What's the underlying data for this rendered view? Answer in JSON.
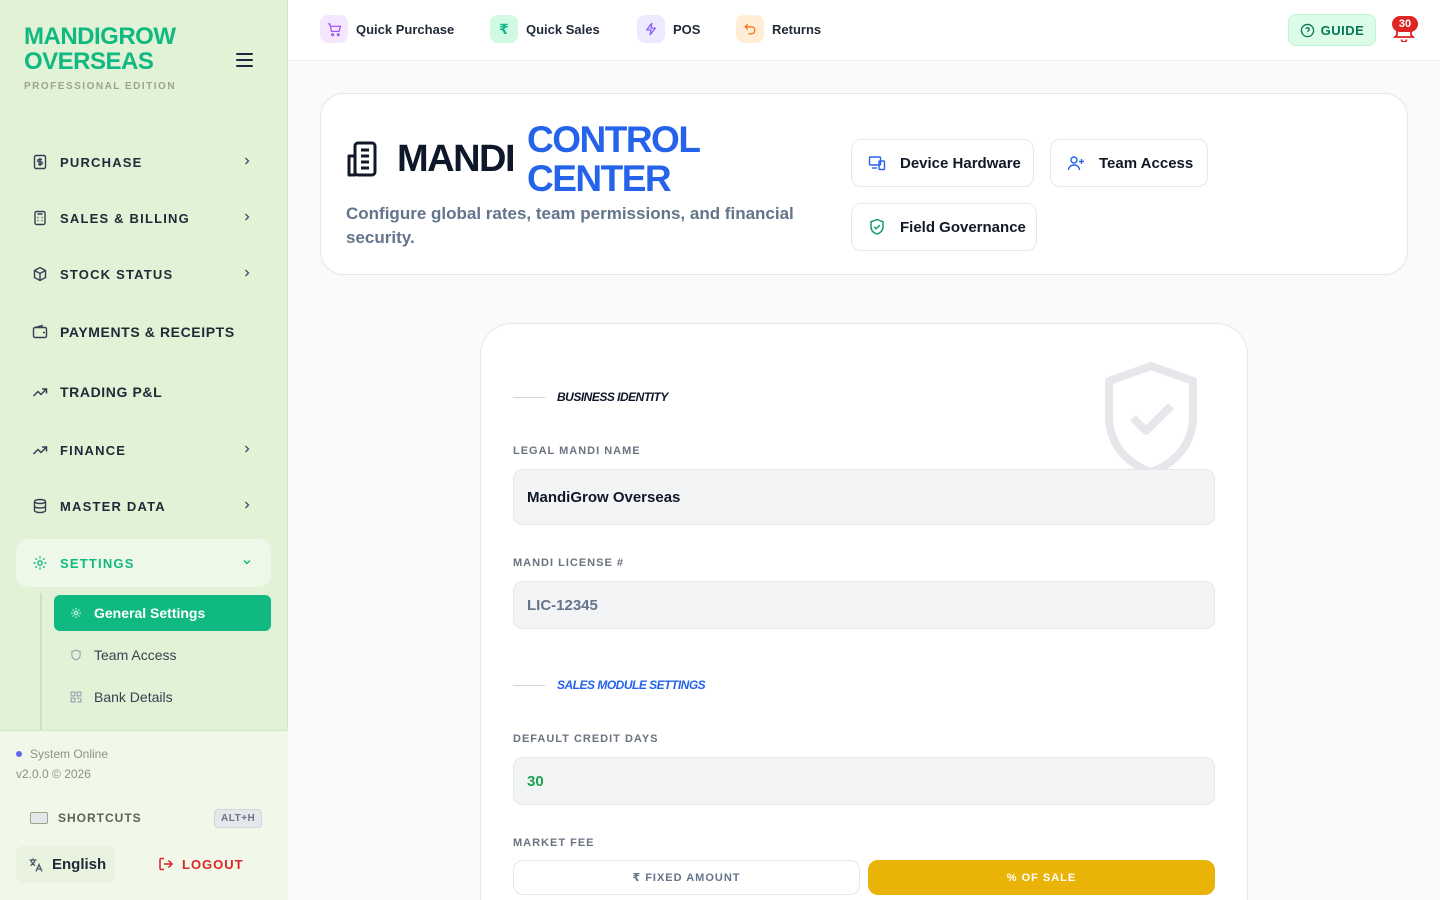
{
  "brand": {
    "line1": "MANDIGROW",
    "line2": "OVERSEAS",
    "edition": "PROFESSIONAL EDITION"
  },
  "sidebar": {
    "items": [
      {
        "label": "PURCHASE",
        "icon": "receipt-icon",
        "has_chevron": true
      },
      {
        "label": "SALES & BILLING",
        "icon": "calculator-icon",
        "has_chevron": true
      },
      {
        "label": "STOCK STATUS",
        "icon": "box-icon",
        "has_chevron": true
      },
      {
        "label": "PAYMENTS & RECEIPTS",
        "icon": "wallet-icon",
        "has_chevron": false
      },
      {
        "label": "TRADING P&L",
        "icon": "trending-up-icon",
        "has_chevron": false
      },
      {
        "label": "FINANCE",
        "icon": "trending-up-icon",
        "has_chevron": true
      },
      {
        "label": "MASTER DATA",
        "icon": "database-icon",
        "has_chevron": true
      },
      {
        "label": "SETTINGS",
        "icon": "gear-icon",
        "has_chevron": true,
        "expanded": true
      }
    ],
    "sub_items": [
      {
        "label": "General Settings",
        "icon": "gear-icon",
        "active": true
      },
      {
        "label": "Team Access",
        "icon": "shield-icon",
        "active": false
      },
      {
        "label": "Bank Details",
        "icon": "qr-icon",
        "active": false
      }
    ],
    "footer": {
      "status": "System Online",
      "version": "v2.0.0 © 2026",
      "shortcuts_label": "SHORTCUTS",
      "shortcuts_key": "ALT+H",
      "language": "English",
      "logout": "LOGOUT"
    }
  },
  "topbar": {
    "quick_actions": [
      {
        "label": "Quick Purchase",
        "icon": "cart-icon",
        "color": "#a855f7",
        "bg": "#f3e8ff"
      },
      {
        "label": "Quick Sales",
        "icon": "rupee-icon",
        "color": "#10b981",
        "bg": "#d1fae5"
      },
      {
        "label": "POS",
        "icon": "zap-icon",
        "color": "#8b5cf6",
        "bg": "#ede9fe"
      },
      {
        "label": "Returns",
        "icon": "undo-icon",
        "color": "#f97316",
        "bg": "#ffedd5"
      }
    ],
    "guide_label": "GUIDE",
    "notification_count": "30"
  },
  "header": {
    "title_part1": "MANDI",
    "title_part2_line1": "CONTROL",
    "title_part2_line2": "CENTER",
    "subtitle": "Configure global rates, team permissions, and financial security.",
    "buttons": [
      {
        "label": "Device Hardware",
        "icon": "devices-icon",
        "color": "#2563eb"
      },
      {
        "label": "Team Access",
        "icon": "user-plus-icon",
        "color": "#2563eb"
      },
      {
        "label": "Field Governance",
        "icon": "shield-check-icon",
        "color": "#059669"
      }
    ]
  },
  "form": {
    "section_business": "BUSINESS IDENTITY",
    "legal_name_label": "LEGAL MANDI NAME",
    "legal_name_value": "MandiGrow Overseas",
    "license_label": "MANDI LICENSE #",
    "license_value": "LIC-12345",
    "section_sales": "SALES MODULE SETTINGS",
    "credit_days_label": "DEFAULT CREDIT DAYS",
    "credit_days_value": "30",
    "market_fee_label": "MARKET FEE",
    "market_fee_options": [
      "₹ FIXED AMOUNT",
      "% OF SALE"
    ],
    "market_fee_selected": "% OF SALE"
  },
  "colors": {
    "accent": "#10b981",
    "brand_blue": "#2563eb",
    "selected_segment": "#eab308",
    "danger": "#dc2626"
  }
}
